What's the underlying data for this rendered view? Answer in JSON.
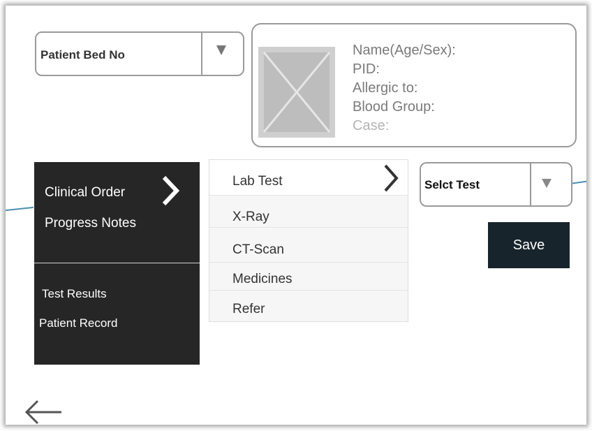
{
  "patient_bed_select": {
    "label": "Patient Bed No"
  },
  "patient_card": {
    "lines": [
      "Name(Age/Sex):",
      "PID:",
      "Allergic to:",
      "Blood Group:",
      "Case:"
    ]
  },
  "left_menu": {
    "primary": [
      "Clinical Order",
      "Progress Notes"
    ],
    "secondary": [
      "Test Results",
      "Patient Record"
    ]
  },
  "order_list": {
    "items": [
      "Lab Test",
      "X-Ray",
      "CT-Scan",
      "Medicines",
      "Refer"
    ],
    "active_index": 0
  },
  "test_select": {
    "label": "Selct Test"
  },
  "save_button": {
    "label": "Save"
  },
  "colors": {
    "menu_bg": "#262626",
    "save_bg": "#18242b",
    "accent_line": "#4a8fb0",
    "border": "#9a9a9a"
  },
  "icons": {
    "dropdown": "triangle-down",
    "menu_chevron": "chevron-right",
    "back": "arrow-left",
    "photo_placeholder": "image-placeholder"
  }
}
